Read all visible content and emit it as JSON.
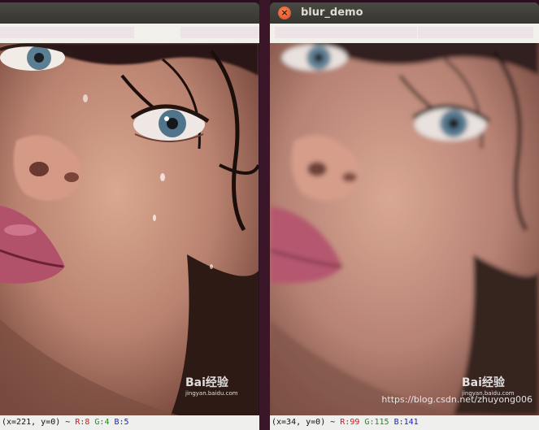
{
  "left_window": {
    "title": "",
    "status": {
      "coords": "(x=221, y=0) ~ ",
      "r": "R:8",
      "g": "G:4",
      "b": "B:5"
    },
    "watermark": {
      "logo": "Bai经验",
      "sub": "jingyan.baidu.com"
    }
  },
  "right_window": {
    "title": "blur_demo",
    "close_glyph": "×",
    "status": {
      "coords": "(x=34, y=0) ~ ",
      "r": "R:99",
      "g": "G:115",
      "b": "B:141"
    },
    "watermark": {
      "logo": "Bai经验",
      "sub": "jingyan.baidu.com"
    },
    "credit": "https://blog.csdn.net/zhuyong006"
  },
  "colors": {
    "desktop": "#3a1628",
    "titlebar": "#3f3e39",
    "toolbar": "#f2f0ea",
    "statusbar": "#efefed",
    "close_button": "#e0441c"
  }
}
